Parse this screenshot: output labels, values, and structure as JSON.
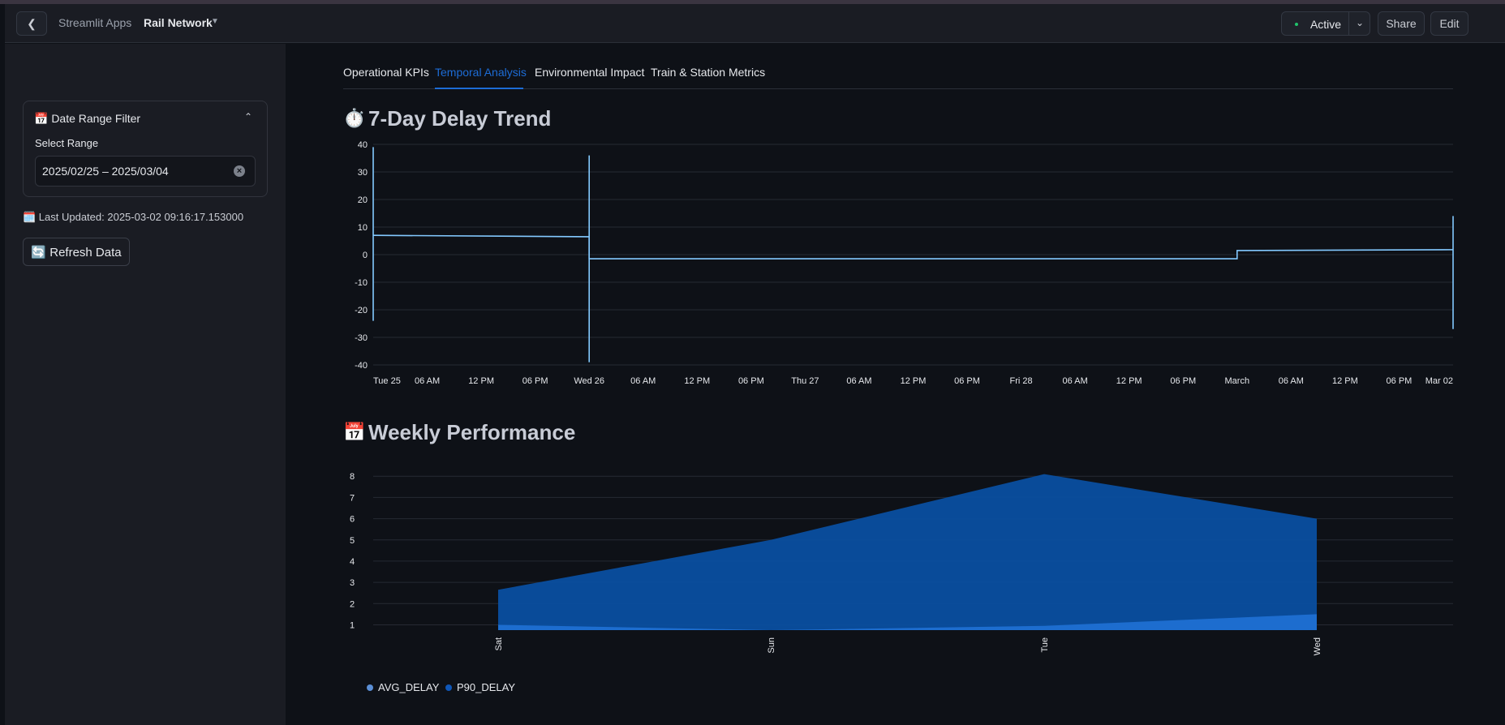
{
  "header": {
    "breadcrumb_apps": "Streamlit Apps",
    "app_name": "Rail Network",
    "status": "Active",
    "share_label": "Share",
    "edit_label": "Edit"
  },
  "sidebar": {
    "filter_title": "📅 Date Range Filter",
    "range_label": "Select Range",
    "range_value": "2025/02/25 – 2025/03/04",
    "last_updated": "🗓️ Last Updated: 2025-03-02 09:16:17.153000",
    "refresh_label": "🔄 Refresh Data"
  },
  "tabs": [
    {
      "label": "Operational KPIs",
      "active": false
    },
    {
      "label": "Temporal Analysis",
      "active": true
    },
    {
      "label": "Environmental Impact",
      "active": false
    },
    {
      "label": "Train & Station Metrics",
      "active": false
    }
  ],
  "sections": {
    "delay_trend_icon": "⏱️",
    "delay_trend_title": "7-Day Delay Trend",
    "weekly_icon": "📅",
    "weekly_title": "Weekly Performance"
  },
  "colors": {
    "accent": "#1d6cd6",
    "line": "#83c9ff",
    "area_p90": "#0a4fa0",
    "area_avg": "#1f6fd2"
  },
  "chart_data": [
    {
      "type": "line",
      "x_labels": [
        "Tue 25",
        "06 AM",
        "12 PM",
        "06 PM",
        "Wed 26",
        "06 AM",
        "12 PM",
        "06 PM",
        "Thu 27",
        "06 AM",
        "12 PM",
        "06 PM",
        "Fri 28",
        "06 AM",
        "12 PM",
        "06 PM",
        "March",
        "06 AM",
        "12 PM",
        "06 PM",
        "Mar 02"
      ],
      "y_ticks": [
        40,
        30,
        20,
        10,
        0,
        -10,
        -20,
        -30,
        -40
      ],
      "ylim": [
        -40,
        40
      ],
      "series": [
        {
          "x": [
            "2025-02-25 00:00",
            "2025-02-26 00:00",
            "2025-02-26 00:00",
            "2025-03-01 00:00",
            "2025-03-01 00:00",
            "2025-03-02 00:00"
          ],
          "values": [
            7,
            6.5,
            -1.5,
            -1.5,
            1.5,
            1.8
          ]
        }
      ],
      "spikes": [
        {
          "x": "2025-02-25 00:00",
          "min": -24,
          "max": 39
        },
        {
          "x": "2025-02-26 00:00",
          "min": -39,
          "max": 36
        },
        {
          "x": "2025-03-02 00:00",
          "min": -27,
          "max": 14
        }
      ]
    },
    {
      "type": "area",
      "categories": [
        "Sat",
        "Sun",
        "Tue",
        "Wed"
      ],
      "y_ticks": [
        8,
        7,
        6,
        5,
        4,
        3,
        2,
        1
      ],
      "ylim": [
        0.75,
        8.2
      ],
      "series": [
        {
          "name": "P90_DELAY",
          "values": [
            2.65,
            5.0,
            8.1,
            6.0
          ]
        },
        {
          "name": "AVG_DELAY",
          "values": [
            1.0,
            0.75,
            0.95,
            1.5
          ]
        }
      ],
      "legend": [
        "AVG_DELAY",
        "P90_DELAY"
      ]
    }
  ]
}
